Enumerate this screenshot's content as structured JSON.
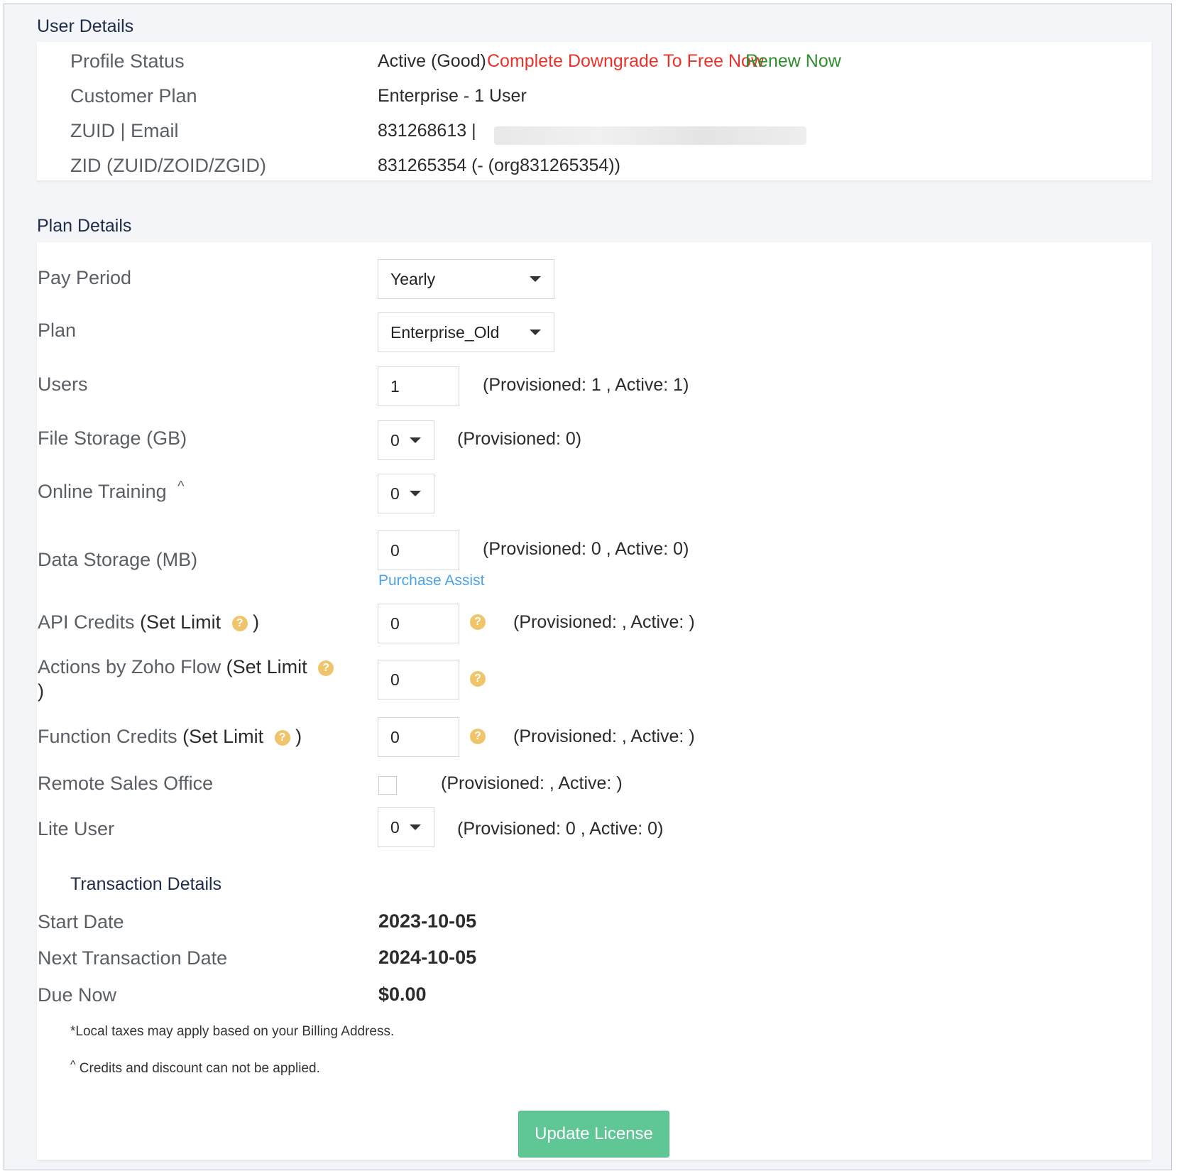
{
  "user_details": {
    "title": "User Details",
    "profile_status_label": "Profile Status",
    "profile_status_value": "Active (Good)",
    "downgrade_link": "Complete Downgrade To Free Now",
    "renew_link": "Renew Now",
    "customer_plan_label": "Customer Plan",
    "customer_plan_value": "Enterprise - 1 User",
    "zuid_email_label": "ZUID | Email",
    "zuid_email_value": "831268613 |",
    "zid_label": "ZID (ZUID/ZOID/ZGID)",
    "zid_value": "831265354 (- (org831265354))"
  },
  "plan_details": {
    "title": "Plan Details",
    "pay_period_label": "Pay Period",
    "pay_period_value": "Yearly",
    "plan_label": "Plan",
    "plan_value": "Enterprise_Old",
    "users_label": "Users",
    "users_value": "1",
    "users_note": "(Provisioned: 1 , Active: 1)",
    "file_storage_label": "File Storage (GB)",
    "file_storage_value": "0",
    "file_storage_note": "(Provisioned: 0)",
    "online_training_label": "Online Training",
    "online_training_marker": "^",
    "online_training_value": "0",
    "data_storage_label": "Data Storage (MB)",
    "data_storage_value": "0",
    "data_storage_note": "(Provisioned: 0 , Active: 0)",
    "purchase_assist_link": "Purchase Assist",
    "api_credits_label": "API Credits",
    "set_limit_text": "(Set Limit",
    "close_paren": ")",
    "help_glyph": "?",
    "api_credits_value": "0",
    "api_credits_note": "(Provisioned: , Active: )",
    "zoho_flow_label": "Actions by Zoho Flow",
    "zoho_flow_value": "0",
    "function_credits_label": "Function Credits",
    "function_credits_value": "0",
    "function_credits_note": "(Provisioned: , Active: )",
    "remote_sales_label": "Remote Sales Office",
    "remote_sales_note": "(Provisioned: , Active: )",
    "lite_user_label": "Lite User",
    "lite_user_value": "0",
    "lite_user_note": "(Provisioned: 0 , Active: 0)"
  },
  "transaction_details": {
    "title": "Transaction Details",
    "start_date_label": "Start Date",
    "start_date_value": "2023-10-05",
    "next_date_label": "Next Transaction Date",
    "next_date_value": "2024-10-05",
    "due_now_label": "Due Now",
    "due_now_value": "$0.00",
    "tax_note": "*Local taxes may apply based on your Billing Address.",
    "credits_marker": "^",
    "credits_note": "Credits and discount can not be applied."
  },
  "actions": {
    "update_license": "Update License"
  },
  "colors": {
    "downgrade_link": "#e8332a",
    "renew_link": "#2f8f2f",
    "purchase_assist": "#4aa3e6",
    "help_icon": "#f0c46a",
    "update_button": "#5fc795"
  }
}
